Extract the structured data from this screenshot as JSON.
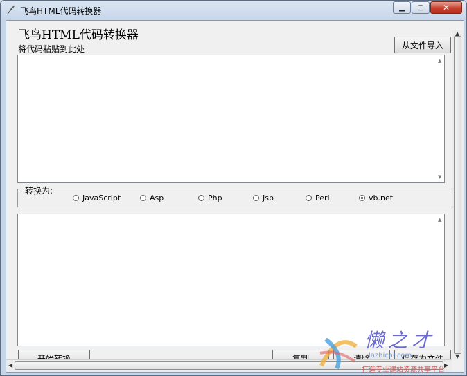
{
  "window": {
    "title": "飞鸟HTML代码转换器",
    "controls": {
      "minimize": "▁",
      "maximize": "▢",
      "close": "✕"
    }
  },
  "main": {
    "heading": "飞鸟HTML代码转换器",
    "paste_label": "将代码粘贴到此处",
    "import_button": "从文件导入",
    "input_value": "",
    "output_value": ""
  },
  "convert": {
    "group_label": "转换为:",
    "options": [
      "JavaScript",
      "Asp",
      "Php",
      "Jsp",
      "Perl",
      "vb.net"
    ],
    "selected": "vb.net"
  },
  "actions": {
    "start": "开始转换",
    "copy": "复制",
    "clear": "清除",
    "save": "保存为文件"
  },
  "watermark": {
    "brand": "懒之才",
    "url": "lazhicai.com",
    "slogan": "打造专业建站资源共享平台"
  }
}
